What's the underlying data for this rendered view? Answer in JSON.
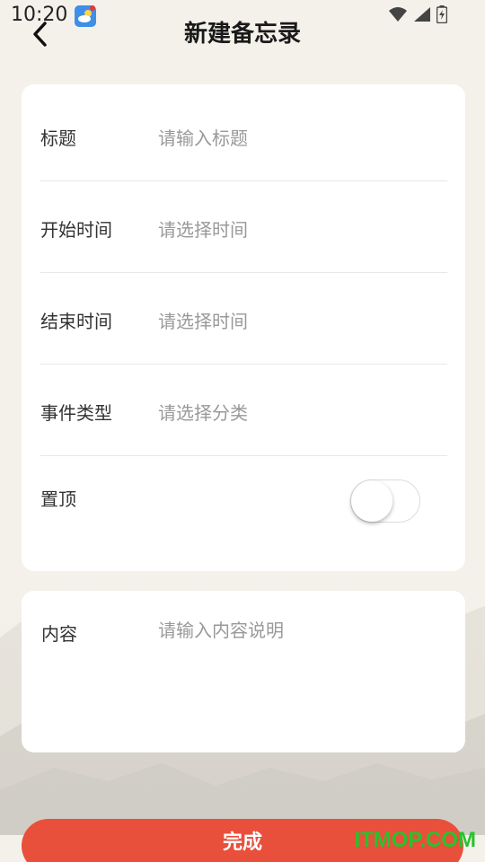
{
  "status_bar": {
    "time": "10:20",
    "icons": [
      "weather-icon",
      "wifi-icon",
      "signal-icon",
      "battery-icon"
    ]
  },
  "header": {
    "title": "新建备忘录",
    "back_icon": "chevron-left-icon"
  },
  "form": {
    "rows": [
      {
        "label": "标题",
        "placeholder": "请输入标题"
      },
      {
        "label": "开始时间",
        "placeholder": "请选择时间"
      },
      {
        "label": "结束时间",
        "placeholder": "请选择时间"
      },
      {
        "label": "事件类型",
        "placeholder": "请选择分类"
      }
    ],
    "pin": {
      "label": "置顶",
      "enabled": false
    }
  },
  "content": {
    "label": "内容",
    "placeholder": "请输入内容说明"
  },
  "footer": {
    "done_label": "完成"
  },
  "watermark": "ITMOP.COM",
  "colors": {
    "accent": "#e8503c",
    "background": "#f4f1ea",
    "watermark": "#26c32b"
  }
}
